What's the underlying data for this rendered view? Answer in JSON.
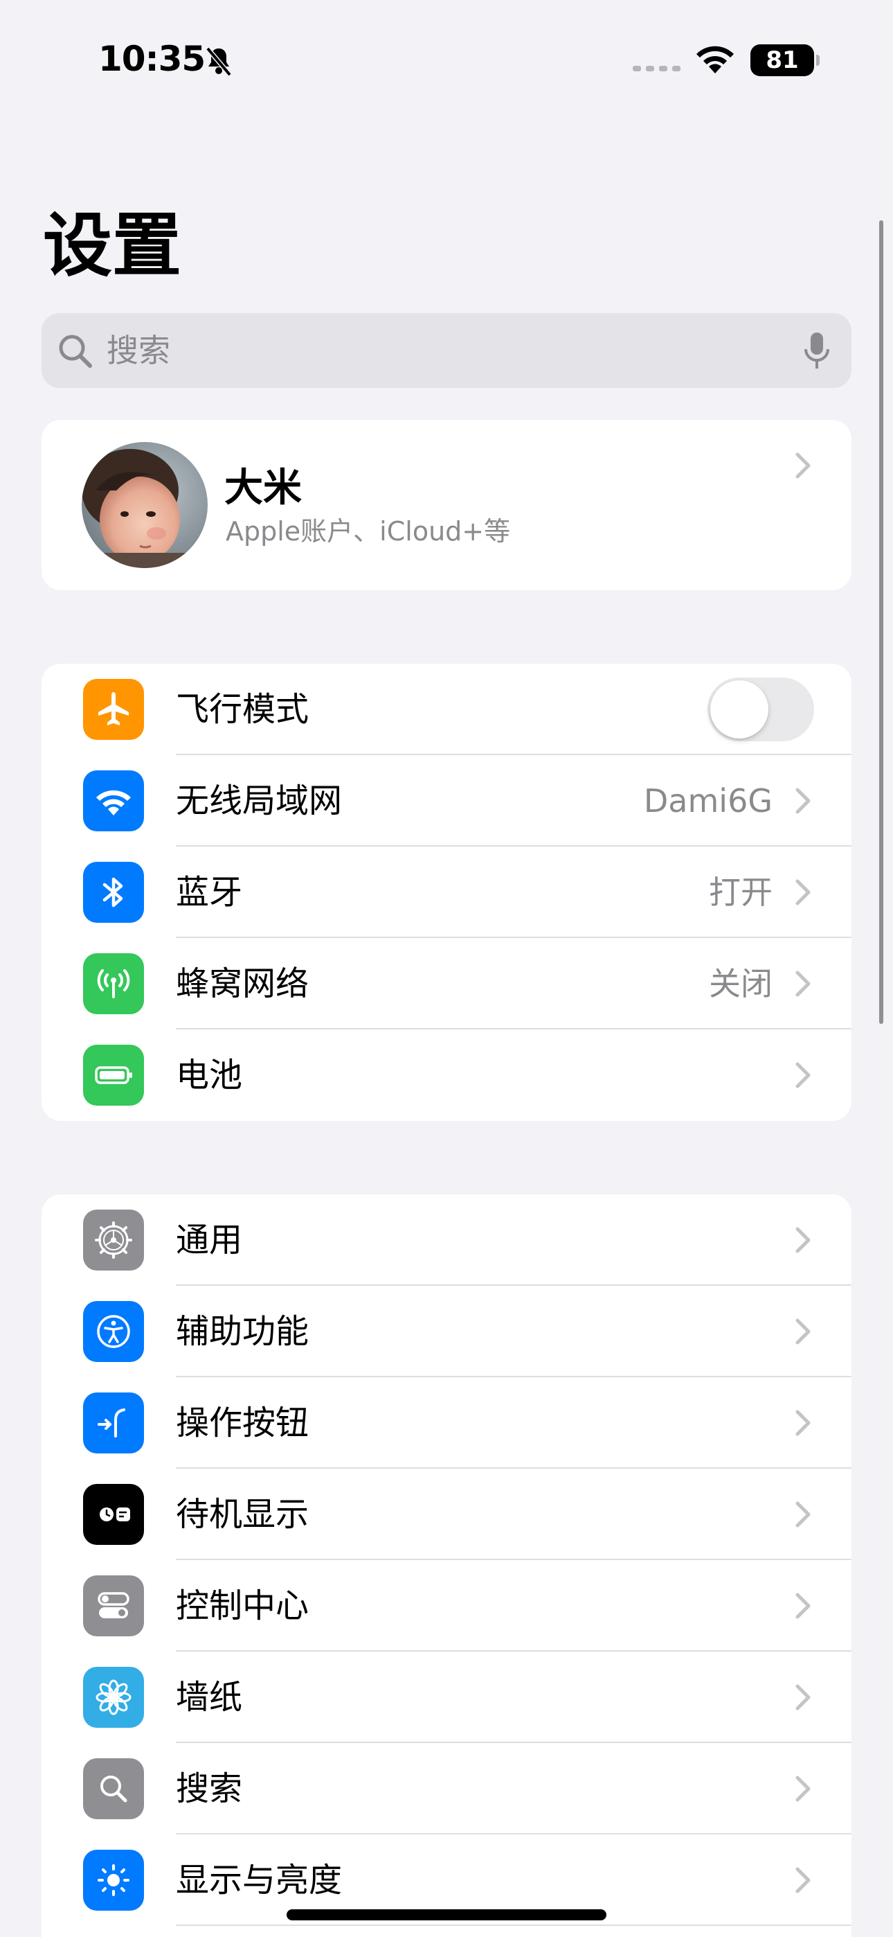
{
  "status_bar": {
    "time": "10:35",
    "battery_level": "81",
    "silent_mode": true
  },
  "page_title": "设置",
  "search": {
    "placeholder": "搜索"
  },
  "account": {
    "name": "大米",
    "subtitle": "Apple账户、iCloud+等"
  },
  "network_group": [
    {
      "label": "飞行模式",
      "icon": "airplane-icon",
      "color": "#ff9500",
      "control": "toggle",
      "toggle_on": false
    },
    {
      "label": "无线局域网",
      "icon": "wifi-icon",
      "color": "#007aff",
      "value": "Dami6G"
    },
    {
      "label": "蓝牙",
      "icon": "bluetooth-icon",
      "color": "#007aff",
      "value": "打开"
    },
    {
      "label": "蜂窝网络",
      "icon": "cellular-icon",
      "color": "#34c759",
      "value": "关闭"
    },
    {
      "label": "电池",
      "icon": "battery-icon",
      "color": "#34c759",
      "value": ""
    }
  ],
  "general_group": [
    {
      "label": "通用",
      "icon": "gear-icon",
      "color": "#8e8e93"
    },
    {
      "label": "辅助功能",
      "icon": "accessibility-icon",
      "color": "#007aff"
    },
    {
      "label": "操作按钮",
      "icon": "action-button-icon",
      "color": "#007aff"
    },
    {
      "label": "待机显示",
      "icon": "standby-icon",
      "color": "#000000"
    },
    {
      "label": "控制中心",
      "icon": "control-center-icon",
      "color": "#8e8e93"
    },
    {
      "label": "墙纸",
      "icon": "wallpaper-icon",
      "color": "#32ade6"
    },
    {
      "label": "搜索",
      "icon": "search-app-icon",
      "color": "#8e8e93"
    },
    {
      "label": "显示与亮度",
      "icon": "brightness-icon",
      "color": "#007aff"
    }
  ]
}
